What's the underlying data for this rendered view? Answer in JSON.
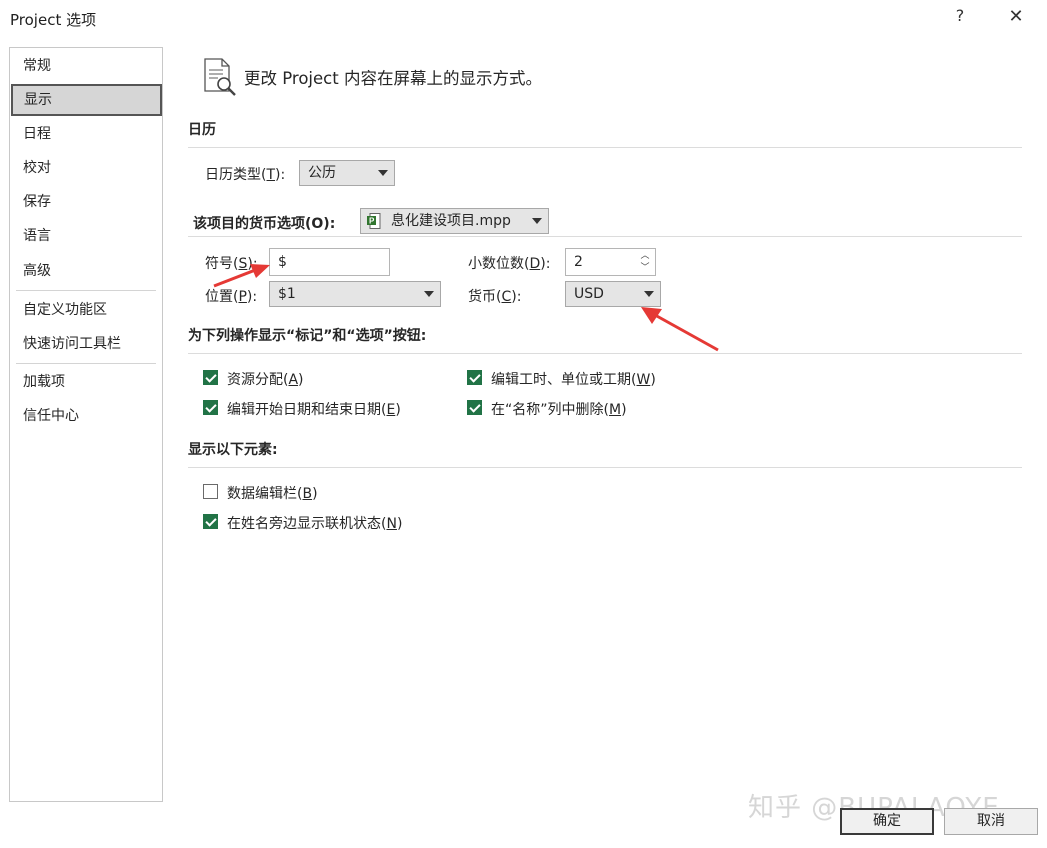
{
  "window": {
    "title": "Project 选项",
    "help": "?",
    "close": "✕"
  },
  "sidebar": {
    "items": [
      {
        "label": "常规"
      },
      {
        "label": "显示",
        "active": true
      },
      {
        "label": "日程"
      },
      {
        "label": "校对"
      },
      {
        "label": "保存"
      },
      {
        "label": "语言"
      },
      {
        "label": "高级"
      },
      {
        "label": "自定义功能区"
      },
      {
        "label": "快速访问工具栏"
      },
      {
        "label": "加载项"
      },
      {
        "label": "信任中心"
      }
    ]
  },
  "header": {
    "text": "更改 Project 内容在屏幕上的显示方式。",
    "icon": "document-magnifier-icon"
  },
  "calendar": {
    "section_title": "日历",
    "type_label": "日历类型(",
    "type_key": "T",
    "type_label_end": "):",
    "type_value": "公历"
  },
  "currency": {
    "section_title": "该项目的货币选项(O):",
    "project_value": "息化建设项目.mpp",
    "symbol_label": "符号(",
    "symbol_key": "S",
    "symbol_label_end": "):",
    "symbol_value": "$",
    "decimals_label": "小数位数(",
    "decimals_key": "D",
    "decimals_label_end": "):",
    "decimals_value": "2",
    "placement_label": "位置(",
    "placement_key": "P",
    "placement_label_end": "):",
    "placement_value": "$1",
    "currency_label": "货币(",
    "currency_key": "C",
    "currency_label_end": "):",
    "currency_value": "USD"
  },
  "indicators": {
    "section_title": "为下列操作显示“标记”和“选项”按钮:",
    "items": [
      {
        "label": "资源分配(",
        "key": "A",
        "end": ")",
        "checked": true
      },
      {
        "label": "编辑工时、单位或工期(",
        "key": "W",
        "end": ")",
        "checked": true
      },
      {
        "label": "编辑开始日期和结束日期(",
        "key": "E",
        "end": ")",
        "checked": true
      },
      {
        "label": "在“名称”列中删除(",
        "key": "M",
        "end": ")",
        "checked": true
      }
    ]
  },
  "elements": {
    "section_title": "显示以下元素:",
    "items": [
      {
        "label": "数据编辑栏(",
        "key": "B",
        "end": ")",
        "checked": false
      },
      {
        "label": "在姓名旁边显示联机状态(",
        "key": "N",
        "end": ")",
        "checked": true
      }
    ]
  },
  "buttons": {
    "ok": "确定",
    "cancel": "取消"
  },
  "watermark": "知乎 @BUPALAOYE",
  "colors": {
    "checkbox_checked": "#217346",
    "annotation_arrow": "#e53935",
    "active_nav": "#d6d6d6"
  }
}
